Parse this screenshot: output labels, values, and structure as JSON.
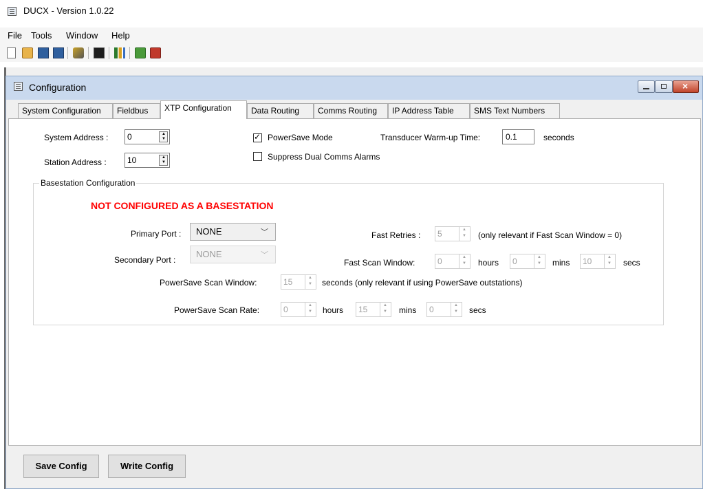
{
  "app": {
    "title": "DUCX - Version 1.0.22"
  },
  "menu": [
    "File",
    "Tools",
    "Window",
    "Help"
  ],
  "toolbar": {
    "icons": [
      "new-icon",
      "open-icon",
      "save-icon",
      "save-as-icon",
      "connect-icon",
      "monitor-icon",
      "chart-icon",
      "upload-icon",
      "download-icon"
    ]
  },
  "window": {
    "title": "Configuration"
  },
  "tabs": [
    "System Configuration",
    "Fieldbus",
    "XTP Configuration",
    "Data Routing",
    "Comms Routing",
    "IP Address Table",
    "SMS Text Numbers"
  ],
  "active_tab": "XTP Configuration",
  "xtp": {
    "system_address_label": "System Address :",
    "system_address": "0",
    "station_address_label": "Station Address :",
    "station_address": "10",
    "powersave_label": "PowerSave Mode",
    "powersave_checked": true,
    "suppress_label": "Suppress Dual Comms Alarms",
    "suppress_checked": false,
    "warmup_label": "Transducer Warm-up Time:",
    "warmup_value": "0.1",
    "warmup_unit": "seconds"
  },
  "basestation": {
    "group_label": "Basestation Configuration",
    "warning": "NOT CONFIGURED AS A BASESTATION",
    "primary_port_label": "Primary Port :",
    "primary_port": "NONE",
    "secondary_port_label": "Secondary Port :",
    "secondary_port": "NONE",
    "fast_retries_label": "Fast Retries :",
    "fast_retries": "5",
    "fast_retries_note": "(only relevant if Fast Scan Window = 0)",
    "fast_scan_label": "Fast Scan Window:",
    "fast_scan_hours": "0",
    "fast_scan_mins": "0",
    "fast_scan_secs": "10",
    "hours_label": "hours",
    "mins_label": "mins",
    "secs_label": "secs",
    "ps_window_label": "PowerSave Scan Window:",
    "ps_window": "15",
    "ps_window_note": "seconds (only relevant if using PowerSave outstations)",
    "ps_rate_label": "PowerSave Scan Rate:",
    "ps_rate_hours": "0",
    "ps_rate_mins": "15",
    "ps_rate_secs": "0"
  },
  "buttons": {
    "save": "Save Config",
    "write": "Write Config"
  }
}
